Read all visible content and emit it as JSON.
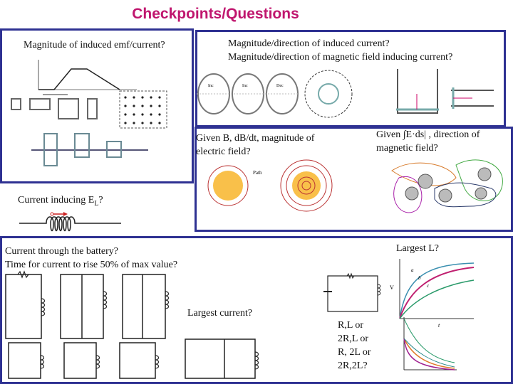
{
  "slide_title": "Checkpoints/Questions",
  "colors": {
    "title": "#c0166e",
    "box_border": "#2e3192"
  },
  "questions": {
    "emf": "Magnitude of induced emf/current?",
    "current_dir_1": "Magnitude/direction of induced current?",
    "current_dir_2": "Magnitude/direction of magnetic field inducing current?",
    "efield_1": "Given B, dB/dt, magnitude of",
    "efield_2": "electric field?",
    "bfield_1": "Given ∫E·ds| , direction of",
    "bfield_2": "magnetic field?",
    "el": "Current inducing E",
    "el_sub": "L",
    "el_q": "?",
    "battery_1": "Current through the battery?",
    "battery_2": "Time for current to rise 50% of max value?",
    "largest_current": "Largest current?",
    "largest_l": "Largest L?",
    "rl_1": "R,L or",
    "rl_2": "2R,L or",
    "rl_3": "R, 2L or",
    "rl_4": "2R,2L?"
  },
  "figure_labels": {
    "path": "Path",
    "inc": "Inc",
    "dec": "Dec",
    "t": "t",
    "vl": "V",
    "curve_a": "a",
    "curve_b": "b",
    "curve_c": "c"
  }
}
